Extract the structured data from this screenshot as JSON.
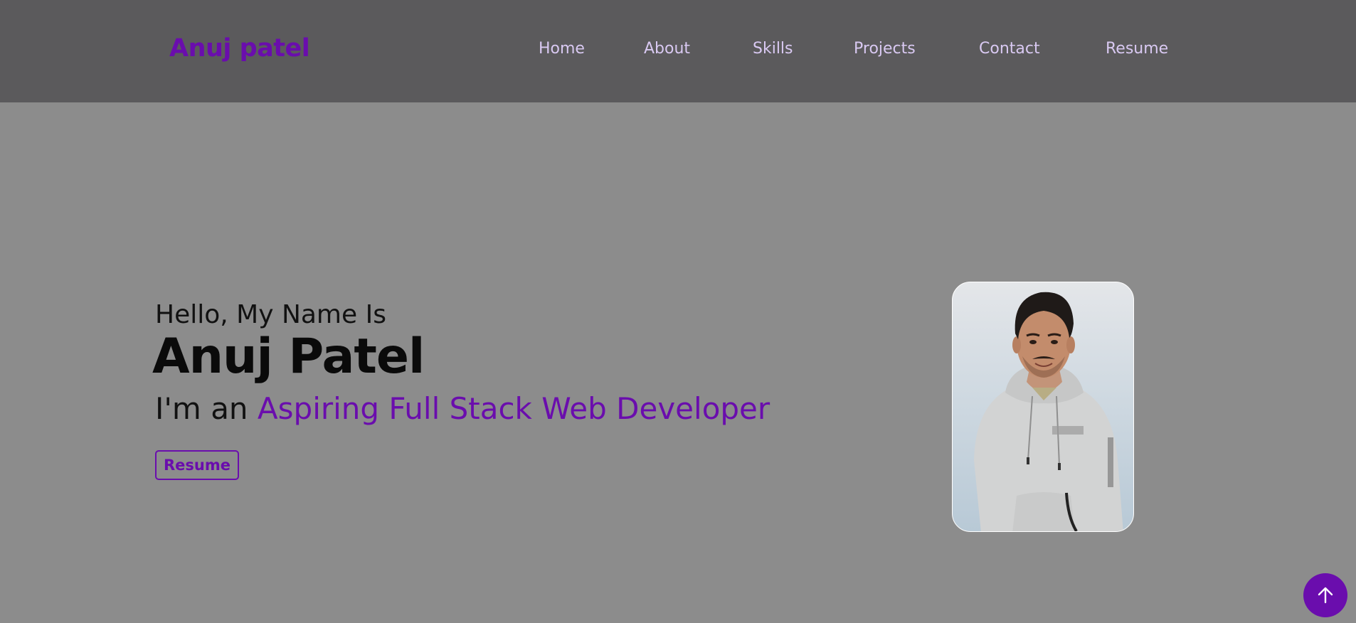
{
  "navbar": {
    "brand": "Anuj patel",
    "links": [
      {
        "label": "Home"
      },
      {
        "label": "About"
      },
      {
        "label": "Skills"
      },
      {
        "label": "Projects"
      },
      {
        "label": "Contact"
      },
      {
        "label": "Resume"
      }
    ]
  },
  "hero": {
    "greeting": "Hello, My Name Is",
    "name": "Anuj Patel",
    "tagline_prefix": "I'm an",
    "tagline_role": "Aspiring Full Stack Web Developer",
    "resume_button": "Resume",
    "photo_icon": "profile-photo"
  },
  "scroll_top": {
    "icon": "arrow-up-icon"
  },
  "colors": {
    "accent": "#6a0dad",
    "nav_bg": "#5b5a5c",
    "page_bg": "#8c8c8c",
    "nav_link": "#d9c9f2"
  }
}
